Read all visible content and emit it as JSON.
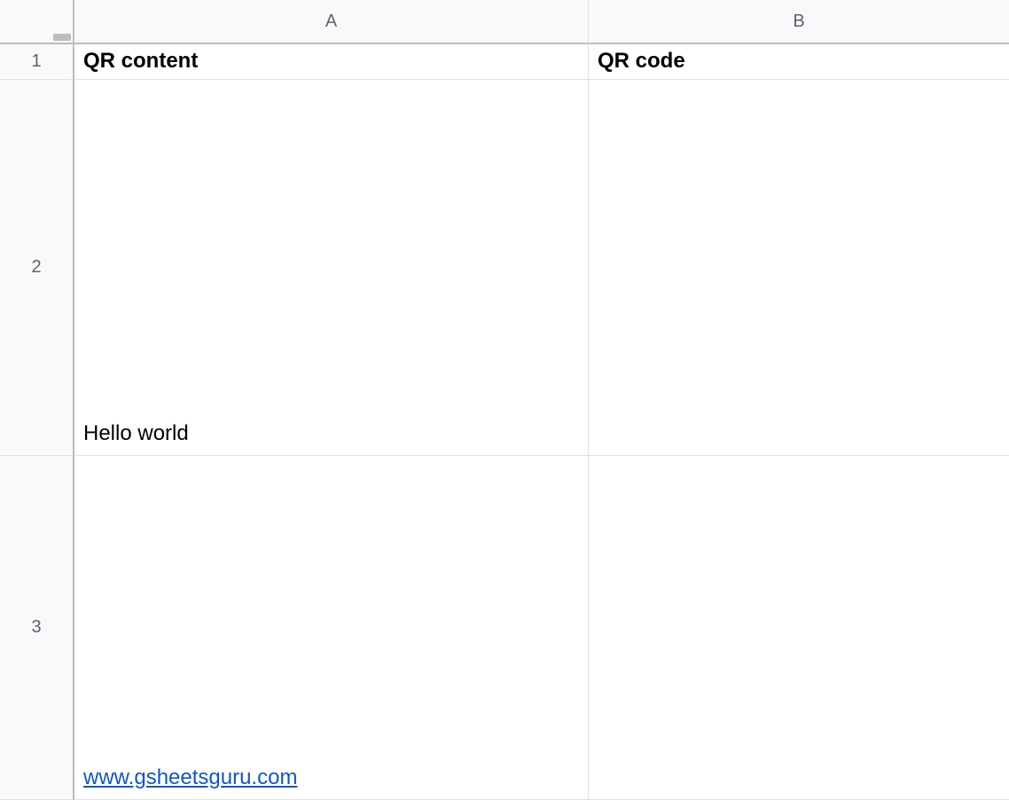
{
  "columns": {
    "A": "A",
    "B": "B"
  },
  "rows": {
    "1": "1",
    "2": "2",
    "3": "3"
  },
  "cells": {
    "A1": "QR content",
    "B1": "QR code",
    "A2": "Hello world",
    "B2": "",
    "A3": "www.gsheetsguru.com",
    "B3": ""
  }
}
